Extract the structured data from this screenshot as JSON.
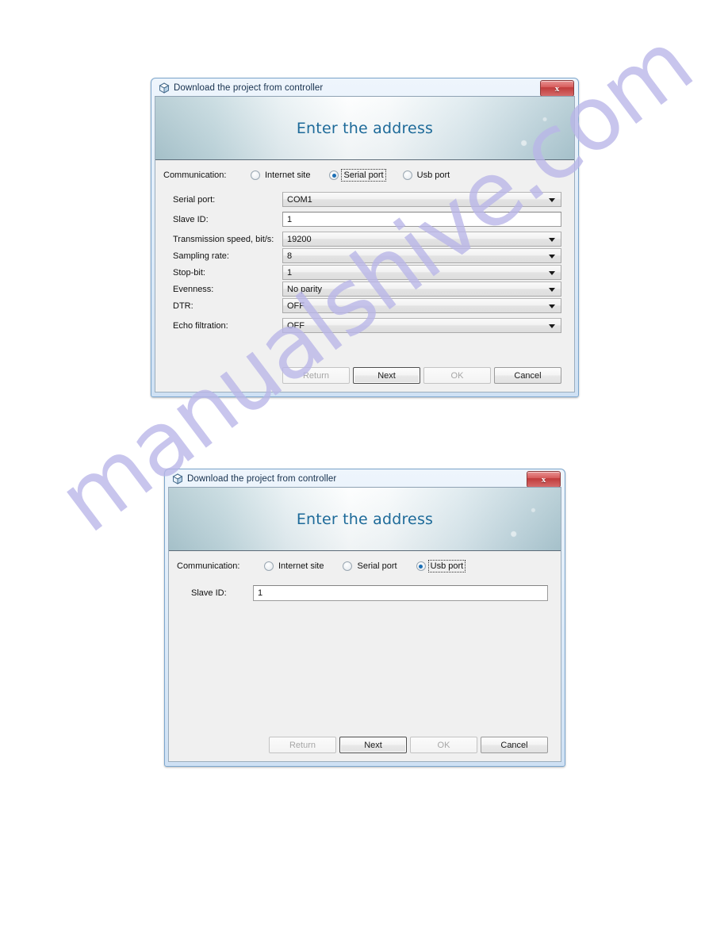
{
  "watermark": {
    "text": "manualshive.com",
    "color": "#b9b6e8"
  },
  "colors": {
    "banner_title": "#1d6a99",
    "close_button": "#c03b3b",
    "radio_selected": "#1b6fb5",
    "client_background": "#f0f0f0"
  },
  "dialogs": [
    {
      "id": "serial",
      "title": "Download the project from controller",
      "icon": "cube-icon",
      "close_label": "x",
      "banner_title": "Enter the address",
      "communication": {
        "label": "Communication:",
        "options": [
          {
            "label": "Internet site",
            "selected": false,
            "focused": false
          },
          {
            "label": "Serial port",
            "selected": true,
            "focused": true
          },
          {
            "label": "Usb port",
            "selected": false,
            "focused": false
          }
        ]
      },
      "fields": [
        {
          "label": "Serial port:",
          "value": "COM1",
          "type": "combo"
        },
        {
          "label": "Slave ID:",
          "value": "1",
          "type": "text"
        },
        {
          "label": "Transmission speed, bit/s:",
          "value": "19200",
          "type": "combo"
        },
        {
          "label": "Sampling rate:",
          "value": "8",
          "type": "combo"
        },
        {
          "label": "Stop-bit:",
          "value": "1",
          "type": "combo"
        },
        {
          "label": "Evenness:",
          "value": "No parity",
          "type": "combo"
        },
        {
          "label": "DTR:",
          "value": "OFF",
          "type": "combo"
        },
        {
          "label": "Echo filtration:",
          "value": "OFF",
          "type": "combo"
        }
      ],
      "buttons": [
        {
          "label": "Return",
          "state": "disabled"
        },
        {
          "label": "Next",
          "state": "default"
        },
        {
          "label": "OK",
          "state": "disabled"
        },
        {
          "label": "Cancel",
          "state": "normal"
        }
      ]
    },
    {
      "id": "usb",
      "title": "Download the project from controller",
      "icon": "cube-icon",
      "close_label": "x",
      "banner_title": "Enter the address",
      "communication": {
        "label": "Communication:",
        "options": [
          {
            "label": "Internet site",
            "selected": false,
            "focused": false
          },
          {
            "label": "Serial port",
            "selected": false,
            "focused": false
          },
          {
            "label": "Usb port",
            "selected": true,
            "focused": true
          }
        ]
      },
      "fields": [
        {
          "label": "Slave ID:",
          "value": "1",
          "type": "text"
        }
      ],
      "buttons": [
        {
          "label": "Return",
          "state": "disabled"
        },
        {
          "label": "Next",
          "state": "default"
        },
        {
          "label": "OK",
          "state": "disabled"
        },
        {
          "label": "Cancel",
          "state": "normal"
        }
      ]
    }
  ]
}
